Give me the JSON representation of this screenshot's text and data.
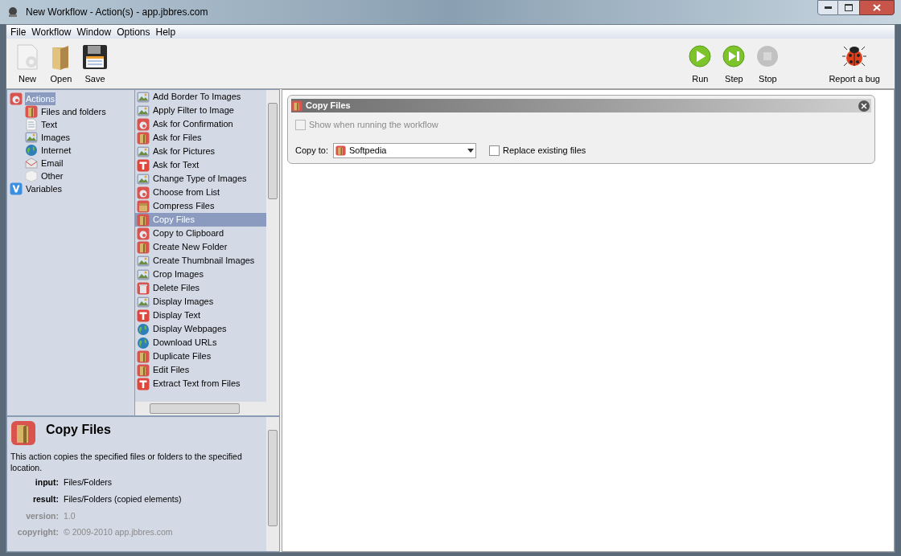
{
  "window": {
    "title": "New Workflow - Action(s) - app.jbbres.com"
  },
  "menu": [
    "File",
    "Workflow",
    "Window",
    "Options",
    "Help"
  ],
  "toolbar_left": [
    {
      "label": "New",
      "kind": "new"
    },
    {
      "label": "Open",
      "kind": "open"
    },
    {
      "label": "Save",
      "kind": "save"
    }
  ],
  "toolbar_right": [
    {
      "label": "Run",
      "kind": "run",
      "disabled": false
    },
    {
      "label": "Step",
      "kind": "step",
      "disabled": false
    },
    {
      "label": "Stop",
      "kind": "stop",
      "disabled": true
    },
    {
      "label": "Report a bug",
      "kind": "bug",
      "disabled": false
    }
  ],
  "tree": [
    {
      "label": "Actions",
      "kind": "dialog",
      "selected": true,
      "children": [
        {
          "label": "Files and folders",
          "kind": "files",
          "selected": false
        },
        {
          "label": "Text",
          "kind": "document",
          "selected": false
        },
        {
          "label": "Images",
          "kind": "images",
          "selected": false
        },
        {
          "label": "Internet",
          "kind": "internet",
          "selected": false
        },
        {
          "label": "Email",
          "kind": "email",
          "selected": false
        },
        {
          "label": "Other",
          "kind": "other",
          "selected": false
        }
      ]
    },
    {
      "label": "Variables",
      "kind": "variables",
      "selected": false
    }
  ],
  "actions": [
    {
      "label": "Add Border To Images",
      "kind": "images",
      "selected": false
    },
    {
      "label": "Apply Filter to Image",
      "kind": "images",
      "selected": false
    },
    {
      "label": "Ask for Confirmation",
      "kind": "dialog",
      "selected": false
    },
    {
      "label": "Ask for Files",
      "kind": "files",
      "selected": false
    },
    {
      "label": "Ask for Pictures",
      "kind": "images",
      "selected": false
    },
    {
      "label": "Ask for Text",
      "kind": "text",
      "selected": false
    },
    {
      "label": "Change Type of Images",
      "kind": "images",
      "selected": false
    },
    {
      "label": "Choose from List",
      "kind": "dialog",
      "selected": false
    },
    {
      "label": "Compress Files",
      "kind": "archive",
      "selected": false
    },
    {
      "label": "Copy Files",
      "kind": "files",
      "selected": true
    },
    {
      "label": "Copy to Clipboard",
      "kind": "dialog",
      "selected": false
    },
    {
      "label": "Create New Folder",
      "kind": "files",
      "selected": false
    },
    {
      "label": "Create Thumbnail Images",
      "kind": "images",
      "selected": false
    },
    {
      "label": "Crop Images",
      "kind": "images",
      "selected": false
    },
    {
      "label": "Delete Files",
      "kind": "delete",
      "selected": false
    },
    {
      "label": "Display Images",
      "kind": "images",
      "selected": false
    },
    {
      "label": "Display Text",
      "kind": "text",
      "selected": false
    },
    {
      "label": "Display Webpages",
      "kind": "internet",
      "selected": false
    },
    {
      "label": "Download URLs",
      "kind": "internet",
      "selected": false
    },
    {
      "label": "Duplicate Files",
      "kind": "files",
      "selected": false
    },
    {
      "label": "Edit Files",
      "kind": "files",
      "selected": false
    },
    {
      "label": "Extract Text from Files",
      "kind": "text",
      "selected": false
    }
  ],
  "description": {
    "title": "Copy Files",
    "text": "This action copies the specified files or folders to the specified location.",
    "fields": [
      {
        "label": "input:",
        "value": "Files/Folders",
        "disabled": false
      },
      {
        "label": "result:",
        "value": "Files/Folders (copied elements)",
        "disabled": false
      },
      {
        "label": "version:",
        "value": "1.0",
        "disabled": true
      },
      {
        "label": "copyright:",
        "value": "© 2009-2010 app.jbbres.com",
        "disabled": true
      }
    ]
  },
  "workflow_card": {
    "title": "Copy Files",
    "show_when_running": {
      "label": "Show when running the workflow",
      "checked": false,
      "disabled": true
    },
    "copy_to_label": "Copy to:",
    "copy_to_value": "Softpedia",
    "replace": {
      "label": "Replace existing files",
      "checked": false,
      "disabled": false
    }
  }
}
